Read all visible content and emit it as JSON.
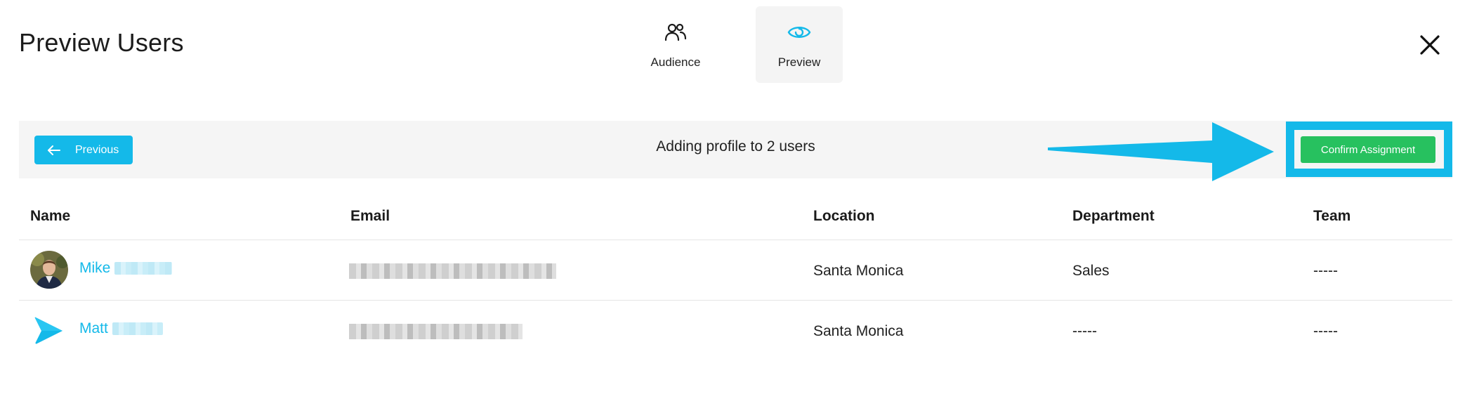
{
  "header": {
    "title": "Preview Users",
    "tabs": [
      {
        "label": "Audience",
        "icon": "users-icon",
        "active": false
      },
      {
        "label": "Preview",
        "icon": "eye-icon",
        "active": true
      }
    ],
    "close_icon": "close-icon"
  },
  "action_bar": {
    "previous_label": "Previous",
    "message": "Adding profile to 2 users",
    "confirm_label": "Confirm Assignment"
  },
  "table": {
    "columns": [
      "Name",
      "Email",
      "Location",
      "Department",
      "Team"
    ],
    "rows": [
      {
        "name": "Mike",
        "avatar": "photo",
        "location": "Santa Monica",
        "department": "Sales",
        "team": "-----"
      },
      {
        "name": "Matt",
        "avatar": "logo",
        "location": "Santa Monica",
        "department": "-----",
        "team": "-----"
      }
    ]
  },
  "colors": {
    "accent": "#14b9e9",
    "confirm": "#27c15f",
    "bar_background": "#f5f5f5",
    "active_tab": "#f4f4f4"
  }
}
